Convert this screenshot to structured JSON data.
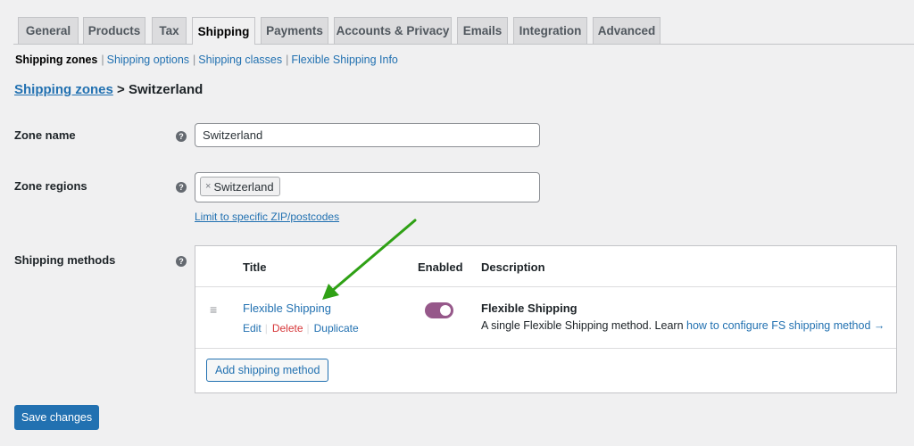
{
  "tabs": [
    "General",
    "Products",
    "Tax",
    "Shipping",
    "Payments",
    "Accounts & Privacy",
    "Emails",
    "Integration",
    "Advanced"
  ],
  "active_tab": "Shipping",
  "subnav": {
    "current": "Shipping zones",
    "links": [
      "Shipping options",
      "Shipping classes",
      "Flexible Shipping Info"
    ],
    "separator": "|"
  },
  "breadcrumb": {
    "link": "Shipping zones",
    "separator": ">",
    "current": "Switzerland"
  },
  "help_glyph": "?",
  "zone_name": {
    "label": "Zone name",
    "value": "Switzerland"
  },
  "zone_regions": {
    "label": "Zone regions",
    "chip_remove": "×",
    "chip": "Switzerland",
    "limit_link": "Limit to specific ZIP/postcodes"
  },
  "shipping_methods": {
    "label": "Shipping methods",
    "headers": {
      "title": "Title",
      "enabled": "Enabled",
      "description": "Description"
    },
    "drag_glyph": "≡",
    "method": {
      "title": "Flexible Shipping",
      "actions": {
        "edit": "Edit",
        "delete": "Delete",
        "duplicate": "Duplicate"
      },
      "enabled": true,
      "description_title": "Flexible Shipping",
      "description_text": "A single Flexible Shipping method. Learn",
      "description_link": "how to configure FS shipping method →"
    },
    "add_button": "Add shipping method"
  },
  "save_button": "Save changes",
  "colors": {
    "link": "#2271b1",
    "toggle_on": "#96588a",
    "delete": "#d63638",
    "annotation_arrow": "#2fa115"
  }
}
